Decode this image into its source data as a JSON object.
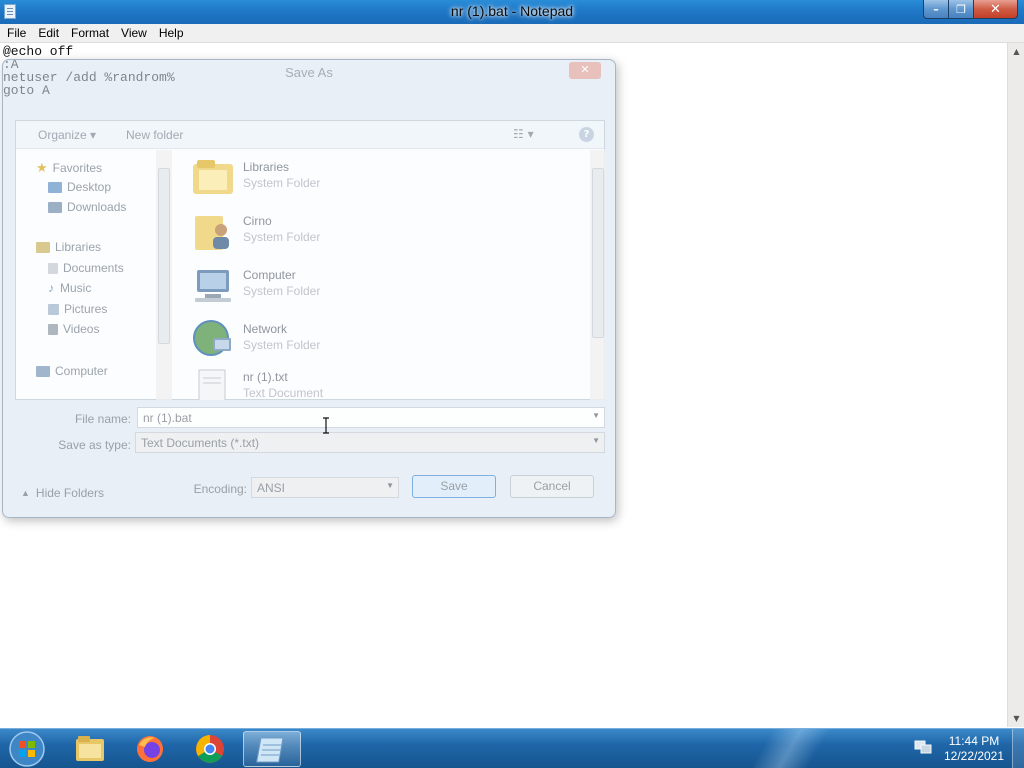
{
  "window": {
    "title": "nr (1).bat - Notepad",
    "minimize_glyph": "–",
    "maximize_glyph": "❐",
    "close_glyph": "✕"
  },
  "menu": [
    "File",
    "Edit",
    "Format",
    "View",
    "Help"
  ],
  "editor": {
    "text": "@echo off\n:A\nnetuser /add %randrom%\ngoto A"
  },
  "dialog": {
    "title": "Save As",
    "close_glyph": "✕",
    "toolbar": {
      "organize": "Organize ▾",
      "new_folder": "New folder",
      "view_glyph": "☷ ▾",
      "help_glyph": "?"
    },
    "nav": {
      "favorites": "Favorites",
      "desktop": "Desktop",
      "downloads": "Downloads",
      "libraries": "Libraries",
      "documents": "Documents",
      "music": "Music",
      "pictures": "Pictures",
      "videos": "Videos",
      "computer": "Computer"
    },
    "files": [
      {
        "name": "Libraries",
        "type": "System Folder",
        "icon": "libraries-icon"
      },
      {
        "name": "Cirno",
        "type": "System Folder",
        "icon": "user-folder-icon"
      },
      {
        "name": "Computer",
        "type": "System Folder",
        "icon": "computer-icon"
      },
      {
        "name": "Network",
        "type": "System Folder",
        "icon": "network-icon"
      },
      {
        "name": "nr (1).txt",
        "type": "Text Document",
        "icon": "text-file-icon"
      }
    ],
    "file_name_label": "File name:",
    "file_name_value": "nr (1).bat",
    "save_type_label": "Save as type:",
    "save_type_value": "Text Documents (*.txt)",
    "hide_folders": "Hide Folders",
    "encoding_label": "Encoding:",
    "encoding_value": "ANSI",
    "save_button": "Save",
    "cancel_button": "Cancel"
  },
  "taskbar": {
    "time": "11:44 PM",
    "date": "12/22/2021",
    "apps": [
      "file-explorer-icon",
      "firefox-icon",
      "chrome-icon",
      "notepad-icon"
    ]
  }
}
